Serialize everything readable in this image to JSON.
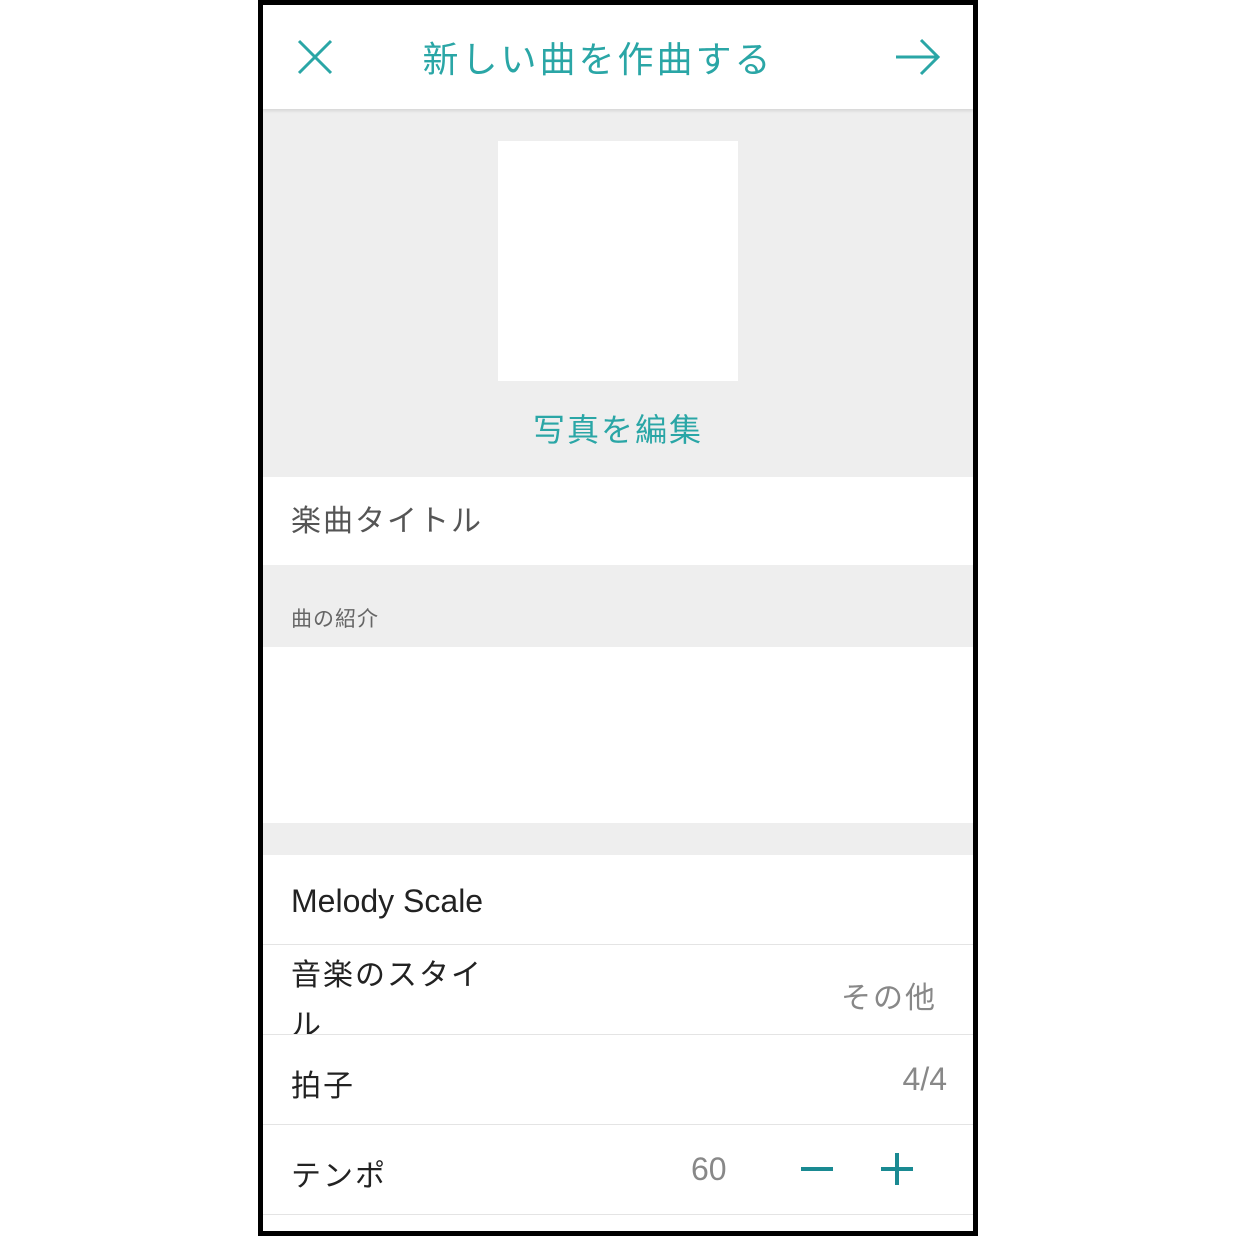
{
  "header": {
    "title": "新しい曲を作曲する",
    "close_icon": "close-icon",
    "next_icon": "arrow-right-icon",
    "accent_color": "#2aa6a6"
  },
  "photo": {
    "edit_label": "写真を編集"
  },
  "song": {
    "title_placeholder": "楽曲タイトル",
    "title_value": "",
    "description_label": "曲の紹介",
    "description_value": ""
  },
  "settings": {
    "scale": {
      "label": "Melody Scale"
    },
    "style": {
      "label": "音楽のスタイル",
      "value": "その他"
    },
    "meter": {
      "label": "拍子",
      "value": "4/4"
    },
    "tempo": {
      "label": "テンポ",
      "value": "60",
      "minus_icon": "minus-icon",
      "plus_icon": "plus-icon"
    }
  }
}
